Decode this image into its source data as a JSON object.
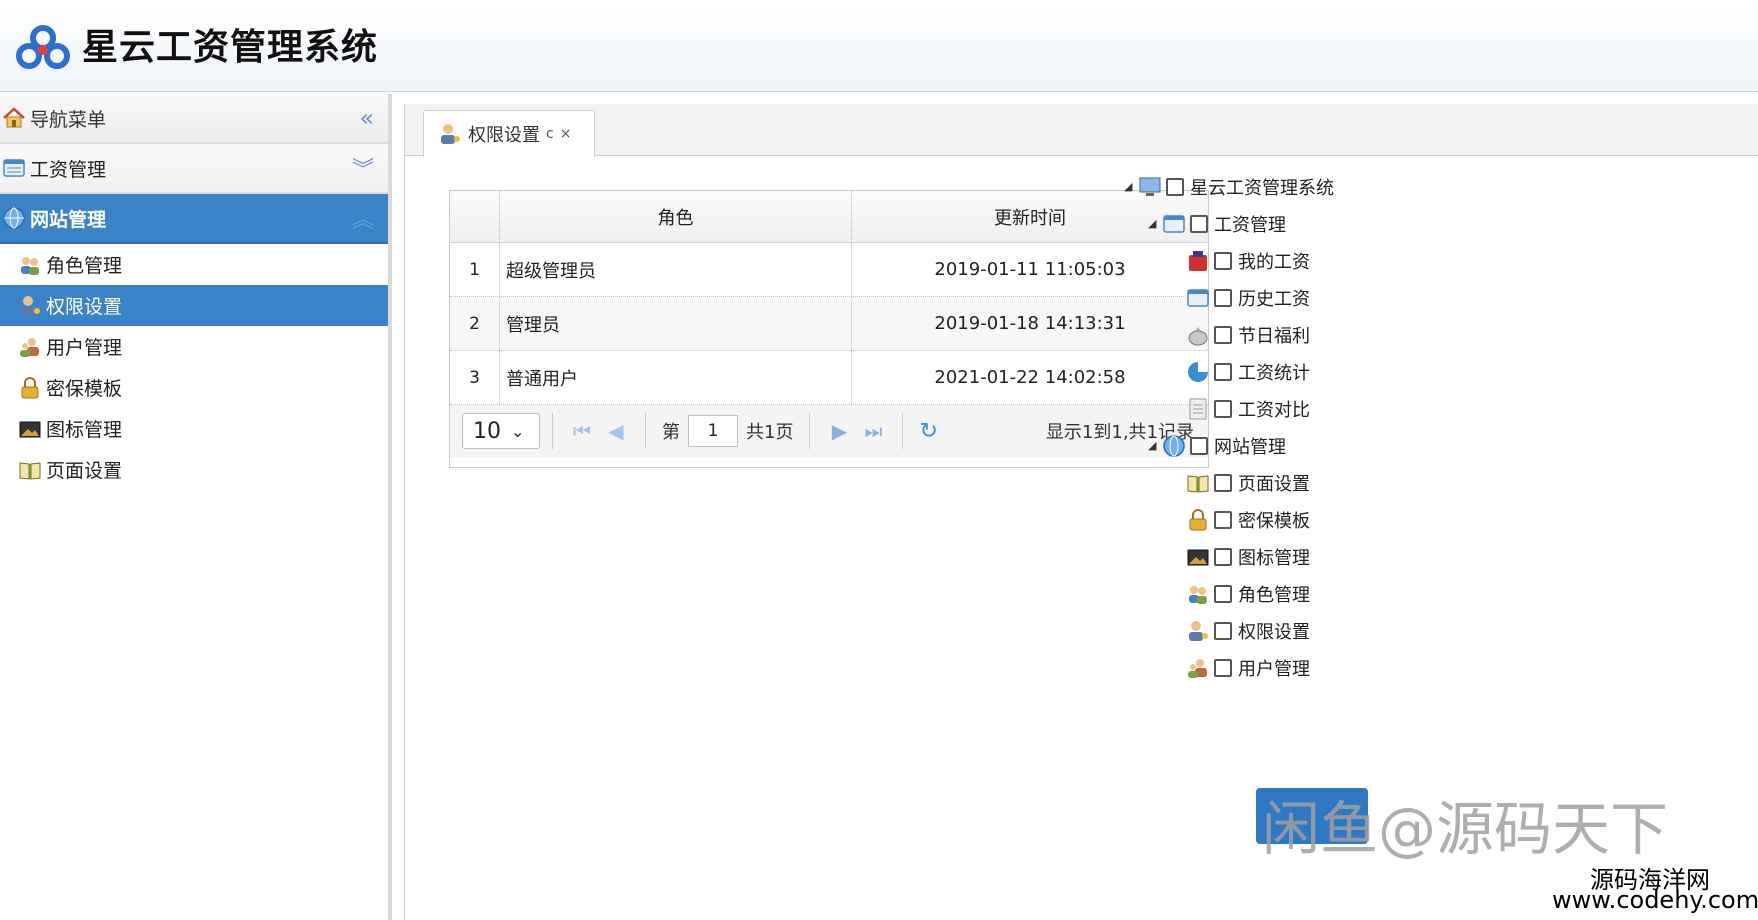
{
  "header": {
    "title": "星云工资管理系统",
    "logo": "cloud-logo"
  },
  "sidebar": {
    "nav_title": "导航菜单",
    "groups": [
      {
        "label": "工资管理",
        "icon": "calendar-icon"
      },
      {
        "label": "网站管理",
        "icon": "globe-icon",
        "active": true
      }
    ],
    "items": [
      {
        "label": "角色管理",
        "icon": "users-icon"
      },
      {
        "label": "权限设置",
        "icon": "user-key-icon",
        "selected": true
      },
      {
        "label": "用户管理",
        "icon": "user-icon"
      },
      {
        "label": "密保模板",
        "icon": "lock-icon"
      },
      {
        "label": "图标管理",
        "icon": "image-icon"
      },
      {
        "label": "页面设置",
        "icon": "book-icon"
      }
    ]
  },
  "tab": {
    "label": "权限设置",
    "refresh": "c",
    "close": "×"
  },
  "grid": {
    "headers": [
      "角色",
      "更新时间"
    ],
    "rows": [
      {
        "num": "1",
        "role": "超级管理员",
        "time": "2019-01-11 11:05:03"
      },
      {
        "num": "2",
        "role": "管理员",
        "time": "2019-01-18 14:13:31"
      },
      {
        "num": "3",
        "role": "普通用户",
        "time": "2021-01-22 14:02:58"
      }
    ],
    "pager": {
      "page_size": "10",
      "page_prefix": "第",
      "page_value": "1",
      "page_suffix": "共1页",
      "info": "显示1到1,共1记录"
    }
  },
  "tree": [
    {
      "label": "星云工资管理系统",
      "icon": "monitor-icon"
    },
    {
      "label": "工资管理",
      "icon": "calendar-icon"
    },
    {
      "label": "我的工资",
      "icon": "wallet-icon"
    },
    {
      "label": "历史工资",
      "icon": "calendar-icon"
    },
    {
      "label": "节日福利",
      "icon": "money-bag-icon"
    },
    {
      "label": "工资统计",
      "icon": "pie-chart-icon"
    },
    {
      "label": "工资对比",
      "icon": "document-icon"
    },
    {
      "label": "网站管理",
      "icon": "globe-icon"
    },
    {
      "label": "页面设置",
      "icon": "book-icon"
    },
    {
      "label": "密保模板",
      "icon": "lock-icon"
    },
    {
      "label": "图标管理",
      "icon": "image-icon"
    },
    {
      "label": "角色管理",
      "icon": "users-icon"
    },
    {
      "label": "权限设置",
      "icon": "user-key-icon"
    },
    {
      "label": "用户管理",
      "icon": "user-icon"
    }
  ],
  "watermark": {
    "main": "闲鱼@源码天下",
    "site_name": "源码海洋网",
    "site_url": "www.codehy.com"
  },
  "colors": {
    "accent": "#3a83c6",
    "pager_icon": "#8ab0e0"
  }
}
